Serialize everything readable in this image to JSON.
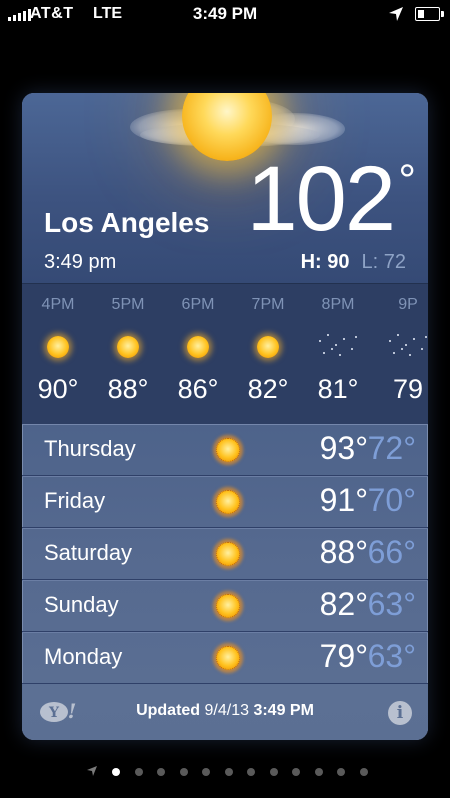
{
  "status_bar": {
    "carrier": "AT&T",
    "network": "LTE",
    "time": "3:49 PM",
    "battery_level": 0.3
  },
  "current": {
    "city": "Los Angeles",
    "time": "3:49 pm",
    "temperature": "102",
    "degree": "°",
    "high_label": "H: 90",
    "low_label": "L: 72",
    "condition_icon": "sun-with-clouds-icon"
  },
  "hourly": [
    {
      "time": "4PM",
      "temp": "90°",
      "icon": "sun-icon"
    },
    {
      "time": "5PM",
      "temp": "88°",
      "icon": "sun-icon"
    },
    {
      "time": "6PM",
      "temp": "86°",
      "icon": "sun-icon"
    },
    {
      "time": "7PM",
      "temp": "82°",
      "icon": "sun-icon"
    },
    {
      "time": "8PM",
      "temp": "81°",
      "icon": "night-stars-icon"
    },
    {
      "time": "9P",
      "temp": "79",
      "icon": "night-stars-icon"
    }
  ],
  "daily": [
    {
      "day": "Thursday",
      "high": "93°",
      "low": "72°",
      "icon": "sun-icon"
    },
    {
      "day": "Friday",
      "high": "91°",
      "low": "70°",
      "icon": "sun-icon"
    },
    {
      "day": "Saturday",
      "high": "88°",
      "low": "66°",
      "icon": "sun-icon"
    },
    {
      "day": "Sunday",
      "high": "82°",
      "low": "63°",
      "icon": "sun-icon"
    },
    {
      "day": "Monday",
      "high": "79°",
      "low": "63°",
      "icon": "sun-icon"
    }
  ],
  "footer": {
    "updated_label": "Updated",
    "updated_date": "9/4/13",
    "updated_time": "3:49 PM",
    "info_glyph": "i"
  },
  "pager": {
    "page_count": 13,
    "active_index": 1
  },
  "colors": {
    "background": "#000000",
    "card_top": "#4c6796",
    "hourly_band": "#2d3e63",
    "low_temp": "#7e9ed7",
    "hour_label": "#7f93b6"
  }
}
